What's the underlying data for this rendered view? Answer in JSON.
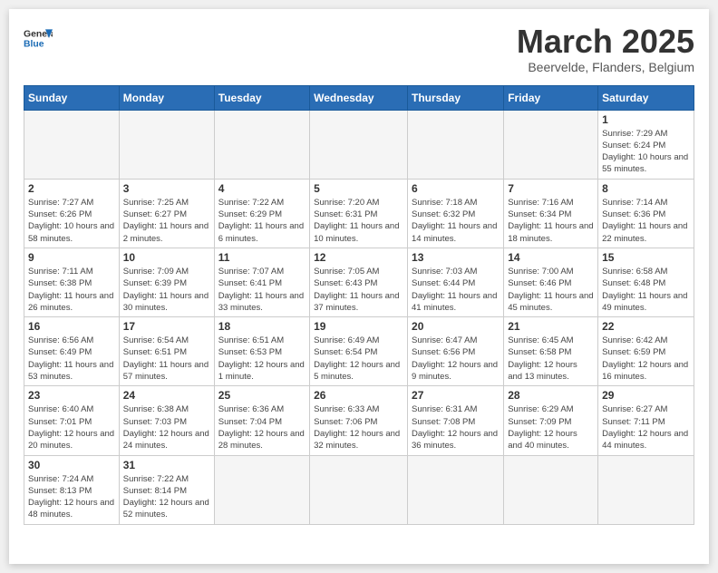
{
  "header": {
    "logo_general": "General",
    "logo_blue": "Blue",
    "month_title": "March 2025",
    "subtitle": "Beervelde, Flanders, Belgium"
  },
  "days_of_week": [
    "Sunday",
    "Monday",
    "Tuesday",
    "Wednesday",
    "Thursday",
    "Friday",
    "Saturday"
  ],
  "weeks": [
    [
      {
        "day": "",
        "info": ""
      },
      {
        "day": "",
        "info": ""
      },
      {
        "day": "",
        "info": ""
      },
      {
        "day": "",
        "info": ""
      },
      {
        "day": "",
        "info": ""
      },
      {
        "day": "",
        "info": ""
      },
      {
        "day": "1",
        "info": "Sunrise: 7:29 AM\nSunset: 6:24 PM\nDaylight: 10 hours and 55 minutes."
      }
    ],
    [
      {
        "day": "2",
        "info": "Sunrise: 7:27 AM\nSunset: 6:26 PM\nDaylight: 10 hours and 58 minutes."
      },
      {
        "day": "3",
        "info": "Sunrise: 7:25 AM\nSunset: 6:27 PM\nDaylight: 11 hours and 2 minutes."
      },
      {
        "day": "4",
        "info": "Sunrise: 7:22 AM\nSunset: 6:29 PM\nDaylight: 11 hours and 6 minutes."
      },
      {
        "day": "5",
        "info": "Sunrise: 7:20 AM\nSunset: 6:31 PM\nDaylight: 11 hours and 10 minutes."
      },
      {
        "day": "6",
        "info": "Sunrise: 7:18 AM\nSunset: 6:32 PM\nDaylight: 11 hours and 14 minutes."
      },
      {
        "day": "7",
        "info": "Sunrise: 7:16 AM\nSunset: 6:34 PM\nDaylight: 11 hours and 18 minutes."
      },
      {
        "day": "8",
        "info": "Sunrise: 7:14 AM\nSunset: 6:36 PM\nDaylight: 11 hours and 22 minutes."
      }
    ],
    [
      {
        "day": "9",
        "info": "Sunrise: 7:11 AM\nSunset: 6:38 PM\nDaylight: 11 hours and 26 minutes."
      },
      {
        "day": "10",
        "info": "Sunrise: 7:09 AM\nSunset: 6:39 PM\nDaylight: 11 hours and 30 minutes."
      },
      {
        "day": "11",
        "info": "Sunrise: 7:07 AM\nSunset: 6:41 PM\nDaylight: 11 hours and 33 minutes."
      },
      {
        "day": "12",
        "info": "Sunrise: 7:05 AM\nSunset: 6:43 PM\nDaylight: 11 hours and 37 minutes."
      },
      {
        "day": "13",
        "info": "Sunrise: 7:03 AM\nSunset: 6:44 PM\nDaylight: 11 hours and 41 minutes."
      },
      {
        "day": "14",
        "info": "Sunrise: 7:00 AM\nSunset: 6:46 PM\nDaylight: 11 hours and 45 minutes."
      },
      {
        "day": "15",
        "info": "Sunrise: 6:58 AM\nSunset: 6:48 PM\nDaylight: 11 hours and 49 minutes."
      }
    ],
    [
      {
        "day": "16",
        "info": "Sunrise: 6:56 AM\nSunset: 6:49 PM\nDaylight: 11 hours and 53 minutes."
      },
      {
        "day": "17",
        "info": "Sunrise: 6:54 AM\nSunset: 6:51 PM\nDaylight: 11 hours and 57 minutes."
      },
      {
        "day": "18",
        "info": "Sunrise: 6:51 AM\nSunset: 6:53 PM\nDaylight: 12 hours and 1 minute."
      },
      {
        "day": "19",
        "info": "Sunrise: 6:49 AM\nSunset: 6:54 PM\nDaylight: 12 hours and 5 minutes."
      },
      {
        "day": "20",
        "info": "Sunrise: 6:47 AM\nSunset: 6:56 PM\nDaylight: 12 hours and 9 minutes."
      },
      {
        "day": "21",
        "info": "Sunrise: 6:45 AM\nSunset: 6:58 PM\nDaylight: 12 hours and 13 minutes."
      },
      {
        "day": "22",
        "info": "Sunrise: 6:42 AM\nSunset: 6:59 PM\nDaylight: 12 hours and 16 minutes."
      }
    ],
    [
      {
        "day": "23",
        "info": "Sunrise: 6:40 AM\nSunset: 7:01 PM\nDaylight: 12 hours and 20 minutes."
      },
      {
        "day": "24",
        "info": "Sunrise: 6:38 AM\nSunset: 7:03 PM\nDaylight: 12 hours and 24 minutes."
      },
      {
        "day": "25",
        "info": "Sunrise: 6:36 AM\nSunset: 7:04 PM\nDaylight: 12 hours and 28 minutes."
      },
      {
        "day": "26",
        "info": "Sunrise: 6:33 AM\nSunset: 7:06 PM\nDaylight: 12 hours and 32 minutes."
      },
      {
        "day": "27",
        "info": "Sunrise: 6:31 AM\nSunset: 7:08 PM\nDaylight: 12 hours and 36 minutes."
      },
      {
        "day": "28",
        "info": "Sunrise: 6:29 AM\nSunset: 7:09 PM\nDaylight: 12 hours and 40 minutes."
      },
      {
        "day": "29",
        "info": "Sunrise: 6:27 AM\nSunset: 7:11 PM\nDaylight: 12 hours and 44 minutes."
      }
    ],
    [
      {
        "day": "30",
        "info": "Sunrise: 7:24 AM\nSunset: 8:13 PM\nDaylight: 12 hours and 48 minutes."
      },
      {
        "day": "31",
        "info": "Sunrise: 7:22 AM\nSunset: 8:14 PM\nDaylight: 12 hours and 52 minutes."
      },
      {
        "day": "",
        "info": ""
      },
      {
        "day": "",
        "info": ""
      },
      {
        "day": "",
        "info": ""
      },
      {
        "day": "",
        "info": ""
      },
      {
        "day": "",
        "info": ""
      }
    ]
  ]
}
